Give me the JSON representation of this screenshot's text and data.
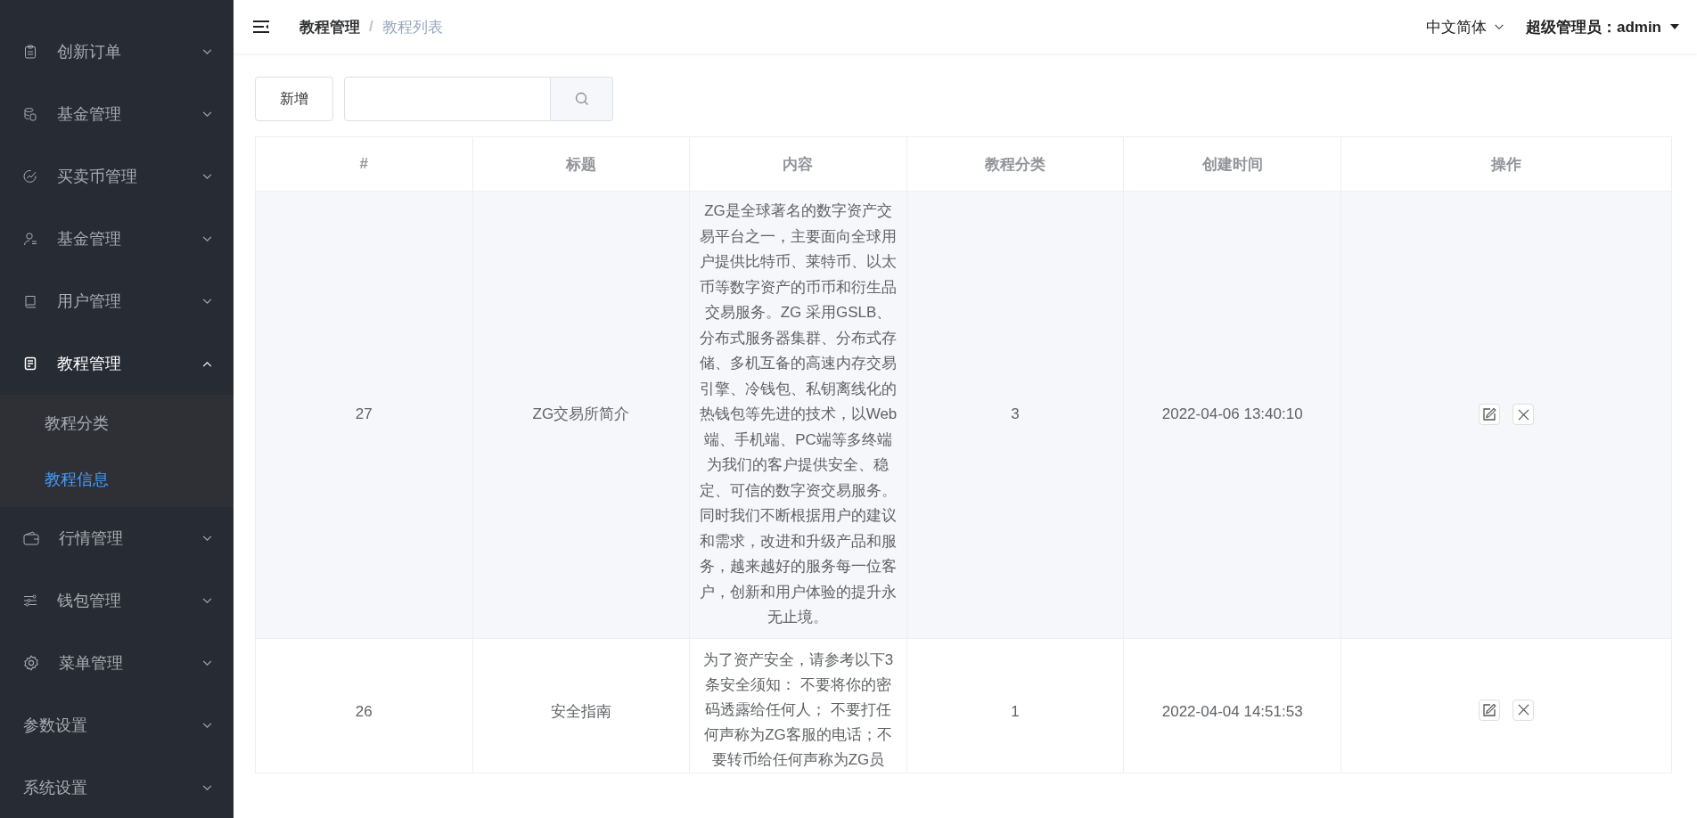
{
  "sidebar": {
    "items": [
      {
        "label": "创新订单",
        "expanded": false
      },
      {
        "label": "基金管理",
        "expanded": false
      },
      {
        "label": "买卖币管理",
        "expanded": false
      },
      {
        "label": "基金管理",
        "expanded": false
      },
      {
        "label": "用户管理",
        "expanded": false
      },
      {
        "label": "教程管理",
        "expanded": true,
        "children": [
          {
            "label": "教程分类",
            "selected": false
          },
          {
            "label": "教程信息",
            "selected": true
          }
        ]
      },
      {
        "label": "行情管理",
        "expanded": false
      },
      {
        "label": "钱包管理",
        "expanded": false
      },
      {
        "label": "菜单管理",
        "expanded": false
      },
      {
        "label": "参数设置",
        "expanded": false
      },
      {
        "label": "系统设置",
        "expanded": false
      }
    ]
  },
  "header": {
    "breadcrumb": [
      "教程管理",
      "教程列表"
    ],
    "separator": "/",
    "language": "中文简体",
    "user": "超级管理员：admin"
  },
  "toolbar": {
    "add_button": "新增"
  },
  "table": {
    "columns": [
      "#",
      "标题",
      "内容",
      "教程分类",
      "创建时间",
      "操作"
    ],
    "rows": [
      {
        "id": "27",
        "title": "ZG交易所简介",
        "content": "ZG是全球著名的数字资产交易平台之一，主要面向全球用户提供比特币、莱特币、以太币等数字资产的币币和衍生品交易服务。ZG 采用GSLB、分布式服务器集群、分布式存储、多机互备的高速内存交易引擎、冷钱包、私钥离线化的热钱包等先进的技术，以Web端、手机端、PC端等多终端为我们的客户提供安全、稳定、可信的数字资交易服务。同时我们不断根据用户的建议和需求，改进和升级产品和服务，越来越好的服务每一位客户，创新和用户体验的提升永无止境。",
        "category": "3",
        "created": "2022-04-06 13:40:10"
      },
      {
        "id": "26",
        "title": "安全指南",
        "content": "为了资产安全，请参考以下3条安全须知： 不要将你的密码透露给任何人； 不要打任何声称为ZG客服的电话；不要转币给任何声称为ZG员",
        "category": "1",
        "created": "2022-04-04 14:51:53"
      }
    ]
  }
}
